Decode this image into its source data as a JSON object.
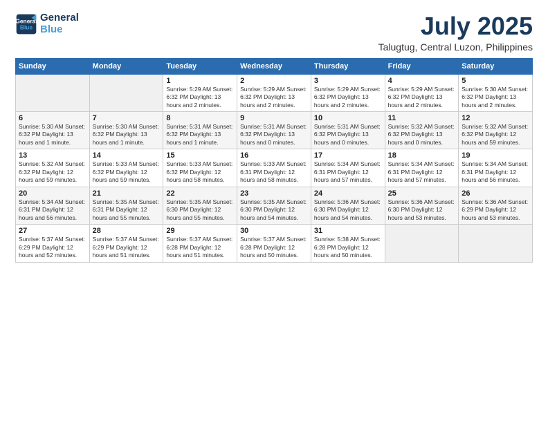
{
  "logo": {
    "line1": "General",
    "line2": "Blue"
  },
  "title": "July 2025",
  "subtitle": "Talugtug, Central Luzon, Philippines",
  "weekdays": [
    "Sunday",
    "Monday",
    "Tuesday",
    "Wednesday",
    "Thursday",
    "Friday",
    "Saturday"
  ],
  "weeks": [
    [
      {
        "day": "",
        "info": ""
      },
      {
        "day": "",
        "info": ""
      },
      {
        "day": "1",
        "info": "Sunrise: 5:29 AM\nSunset: 6:32 PM\nDaylight: 13 hours\nand 2 minutes."
      },
      {
        "day": "2",
        "info": "Sunrise: 5:29 AM\nSunset: 6:32 PM\nDaylight: 13 hours\nand 2 minutes."
      },
      {
        "day": "3",
        "info": "Sunrise: 5:29 AM\nSunset: 6:32 PM\nDaylight: 13 hours\nand 2 minutes."
      },
      {
        "day": "4",
        "info": "Sunrise: 5:29 AM\nSunset: 6:32 PM\nDaylight: 13 hours\nand 2 minutes."
      },
      {
        "day": "5",
        "info": "Sunrise: 5:30 AM\nSunset: 6:32 PM\nDaylight: 13 hours\nand 2 minutes."
      }
    ],
    [
      {
        "day": "6",
        "info": "Sunrise: 5:30 AM\nSunset: 6:32 PM\nDaylight: 13 hours\nand 1 minute."
      },
      {
        "day": "7",
        "info": "Sunrise: 5:30 AM\nSunset: 6:32 PM\nDaylight: 13 hours\nand 1 minute."
      },
      {
        "day": "8",
        "info": "Sunrise: 5:31 AM\nSunset: 6:32 PM\nDaylight: 13 hours\nand 1 minute."
      },
      {
        "day": "9",
        "info": "Sunrise: 5:31 AM\nSunset: 6:32 PM\nDaylight: 13 hours\nand 0 minutes."
      },
      {
        "day": "10",
        "info": "Sunrise: 5:31 AM\nSunset: 6:32 PM\nDaylight: 13 hours\nand 0 minutes."
      },
      {
        "day": "11",
        "info": "Sunrise: 5:32 AM\nSunset: 6:32 PM\nDaylight: 13 hours\nand 0 minutes."
      },
      {
        "day": "12",
        "info": "Sunrise: 5:32 AM\nSunset: 6:32 PM\nDaylight: 12 hours\nand 59 minutes."
      }
    ],
    [
      {
        "day": "13",
        "info": "Sunrise: 5:32 AM\nSunset: 6:32 PM\nDaylight: 12 hours\nand 59 minutes."
      },
      {
        "day": "14",
        "info": "Sunrise: 5:33 AM\nSunset: 6:32 PM\nDaylight: 12 hours\nand 59 minutes."
      },
      {
        "day": "15",
        "info": "Sunrise: 5:33 AM\nSunset: 6:32 PM\nDaylight: 12 hours\nand 58 minutes."
      },
      {
        "day": "16",
        "info": "Sunrise: 5:33 AM\nSunset: 6:31 PM\nDaylight: 12 hours\nand 58 minutes."
      },
      {
        "day": "17",
        "info": "Sunrise: 5:34 AM\nSunset: 6:31 PM\nDaylight: 12 hours\nand 57 minutes."
      },
      {
        "day": "18",
        "info": "Sunrise: 5:34 AM\nSunset: 6:31 PM\nDaylight: 12 hours\nand 57 minutes."
      },
      {
        "day": "19",
        "info": "Sunrise: 5:34 AM\nSunset: 6:31 PM\nDaylight: 12 hours\nand 56 minutes."
      }
    ],
    [
      {
        "day": "20",
        "info": "Sunrise: 5:34 AM\nSunset: 6:31 PM\nDaylight: 12 hours\nand 56 minutes."
      },
      {
        "day": "21",
        "info": "Sunrise: 5:35 AM\nSunset: 6:31 PM\nDaylight: 12 hours\nand 55 minutes."
      },
      {
        "day": "22",
        "info": "Sunrise: 5:35 AM\nSunset: 6:30 PM\nDaylight: 12 hours\nand 55 minutes."
      },
      {
        "day": "23",
        "info": "Sunrise: 5:35 AM\nSunset: 6:30 PM\nDaylight: 12 hours\nand 54 minutes."
      },
      {
        "day": "24",
        "info": "Sunrise: 5:36 AM\nSunset: 6:30 PM\nDaylight: 12 hours\nand 54 minutes."
      },
      {
        "day": "25",
        "info": "Sunrise: 5:36 AM\nSunset: 6:30 PM\nDaylight: 12 hours\nand 53 minutes."
      },
      {
        "day": "26",
        "info": "Sunrise: 5:36 AM\nSunset: 6:29 PM\nDaylight: 12 hours\nand 53 minutes."
      }
    ],
    [
      {
        "day": "27",
        "info": "Sunrise: 5:37 AM\nSunset: 6:29 PM\nDaylight: 12 hours\nand 52 minutes."
      },
      {
        "day": "28",
        "info": "Sunrise: 5:37 AM\nSunset: 6:29 PM\nDaylight: 12 hours\nand 51 minutes."
      },
      {
        "day": "29",
        "info": "Sunrise: 5:37 AM\nSunset: 6:28 PM\nDaylight: 12 hours\nand 51 minutes."
      },
      {
        "day": "30",
        "info": "Sunrise: 5:37 AM\nSunset: 6:28 PM\nDaylight: 12 hours\nand 50 minutes."
      },
      {
        "day": "31",
        "info": "Sunrise: 5:38 AM\nSunset: 6:28 PM\nDaylight: 12 hours\nand 50 minutes."
      },
      {
        "day": "",
        "info": ""
      },
      {
        "day": "",
        "info": ""
      }
    ]
  ]
}
